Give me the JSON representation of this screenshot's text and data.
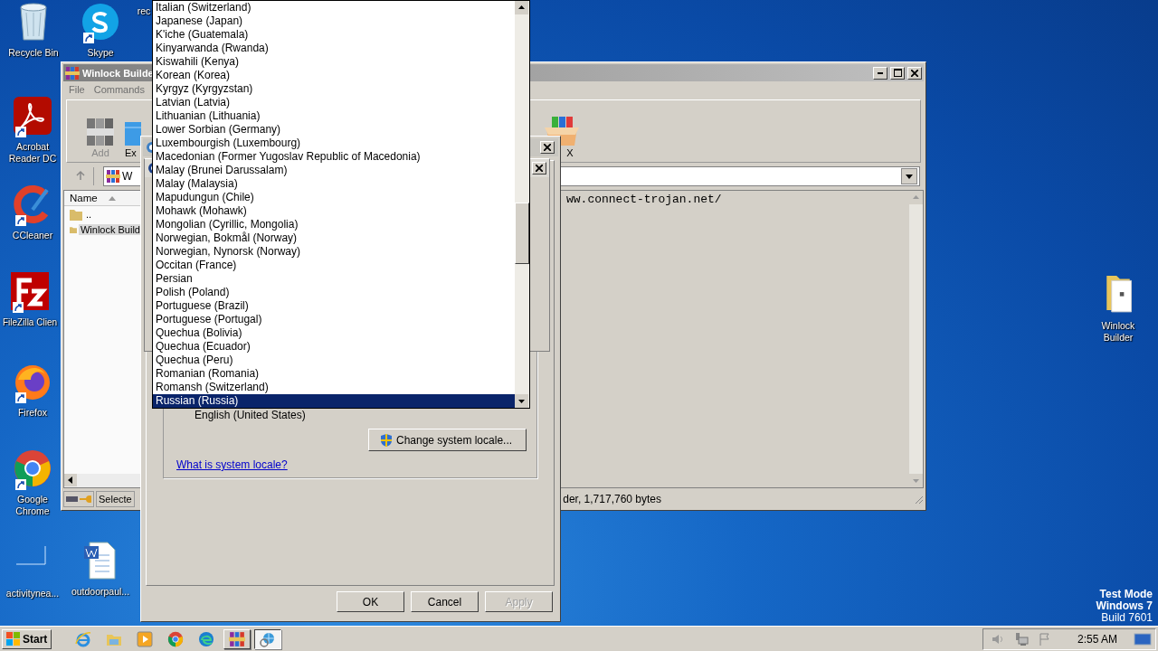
{
  "desktop": {
    "icons": [
      {
        "label": "Recycle Bin",
        "kind": "recycle-bin",
        "shortcut": false
      },
      {
        "label": "Skype",
        "kind": "skype",
        "shortcut": true
      },
      {
        "label": "rec",
        "kind": "none",
        "shortcut": false
      },
      {
        "label": "Acrobat Reader DC",
        "kind": "acrobat",
        "shortcut": true
      },
      {
        "label": "CCleaner",
        "kind": "ccleaner",
        "shortcut": true
      },
      {
        "label": "FileZilla Clien",
        "kind": "filezilla",
        "shortcut": true
      },
      {
        "label": "Firefox",
        "kind": "firefox",
        "shortcut": true
      },
      {
        "label": "Google Chrome",
        "kind": "chrome",
        "shortcut": true
      },
      {
        "label": "activityneа...",
        "kind": "blank",
        "shortcut": false
      },
      {
        "label": "outdoorpaul...",
        "kind": "word",
        "shortcut": false
      },
      {
        "label": "Winlock Builder",
        "kind": "folder",
        "shortcut": false
      }
    ]
  },
  "winrar": {
    "title": "Winlock Builde",
    "menu": [
      "File",
      "Commands"
    ],
    "toolbar": [
      {
        "label": "Add",
        "kind": "add"
      },
      {
        "label": "Ex",
        "kind": "extract"
      },
      {
        "label": "X",
        "kind": "sfx"
      }
    ],
    "address": "W",
    "file_list": {
      "column": "Name",
      "rows": [
        {
          "name": "..",
          "selected": false
        },
        {
          "name": "Winlock Build",
          "selected": true
        }
      ]
    },
    "comment": "ww.connect-trojan.net/",
    "status": {
      "left": "Selecte",
      "right": "der, 1,717,760 bytes"
    }
  },
  "region_dialog": {
    "locale": "English (United States)",
    "change_button": "Change system locale...",
    "link": "What is system locale?",
    "buttons": [
      {
        "label": "OK",
        "disabled": false
      },
      {
        "label": "Cancel",
        "disabled": false
      },
      {
        "label": "Apply",
        "disabled": true
      }
    ]
  },
  "dropdown": {
    "items": [
      {
        "label": "Italian (Switzerland)",
        "selected": false
      },
      {
        "label": "Japanese (Japan)",
        "selected": false
      },
      {
        "label": "K'iche (Guatemala)",
        "selected": false
      },
      {
        "label": "Kinyarwanda (Rwanda)",
        "selected": false
      },
      {
        "label": "Kiswahili (Kenya)",
        "selected": false
      },
      {
        "label": "Korean (Korea)",
        "selected": false
      },
      {
        "label": "Kyrgyz (Kyrgyzstan)",
        "selected": false
      },
      {
        "label": "Latvian (Latvia)",
        "selected": false
      },
      {
        "label": "Lithuanian (Lithuania)",
        "selected": false
      },
      {
        "label": "Lower Sorbian (Germany)",
        "selected": false
      },
      {
        "label": "Luxembourgish (Luxembourg)",
        "selected": false
      },
      {
        "label": "Macedonian (Former Yugoslav Republic of Macedonia)",
        "selected": false
      },
      {
        "label": "Malay (Brunei Darussalam)",
        "selected": false
      },
      {
        "label": "Malay (Malaysia)",
        "selected": false
      },
      {
        "label": "Mapudungun (Chile)",
        "selected": false
      },
      {
        "label": "Mohawk (Mohawk)",
        "selected": false
      },
      {
        "label": "Mongolian (Cyrillic, Mongolia)",
        "selected": false
      },
      {
        "label": "Norwegian, Bokmål (Norway)",
        "selected": false
      },
      {
        "label": "Norwegian, Nynorsk (Norway)",
        "selected": false
      },
      {
        "label": "Occitan (France)",
        "selected": false
      },
      {
        "label": "Persian",
        "selected": false
      },
      {
        "label": "Polish (Poland)",
        "selected": false
      },
      {
        "label": "Portuguese (Brazil)",
        "selected": false
      },
      {
        "label": "Portuguese (Portugal)",
        "selected": false
      },
      {
        "label": "Quechua (Bolivia)",
        "selected": false
      },
      {
        "label": "Quechua (Ecuador)",
        "selected": false
      },
      {
        "label": "Quechua (Peru)",
        "selected": false
      },
      {
        "label": "Romanian (Romania)",
        "selected": false
      },
      {
        "label": "Romansh (Switzerland)",
        "selected": false
      },
      {
        "label": "Russian (Russia)",
        "selected": true
      }
    ]
  },
  "taskbar": {
    "start": "Start",
    "apps": [
      {
        "kind": "ie",
        "running": false,
        "active": false
      },
      {
        "kind": "explorer",
        "running": false,
        "active": false
      },
      {
        "kind": "media",
        "running": false,
        "active": false
      },
      {
        "kind": "chrome",
        "running": false,
        "active": false
      },
      {
        "kind": "edge",
        "running": false,
        "active": false
      },
      {
        "kind": "winrar",
        "running": true,
        "active": false
      },
      {
        "kind": "globe",
        "running": true,
        "active": true
      }
    ],
    "clock": "2:55 AM"
  },
  "os_notice": {
    "mode": "Test Mode",
    "edition": "Windows 7",
    "build": "Build 7601"
  }
}
